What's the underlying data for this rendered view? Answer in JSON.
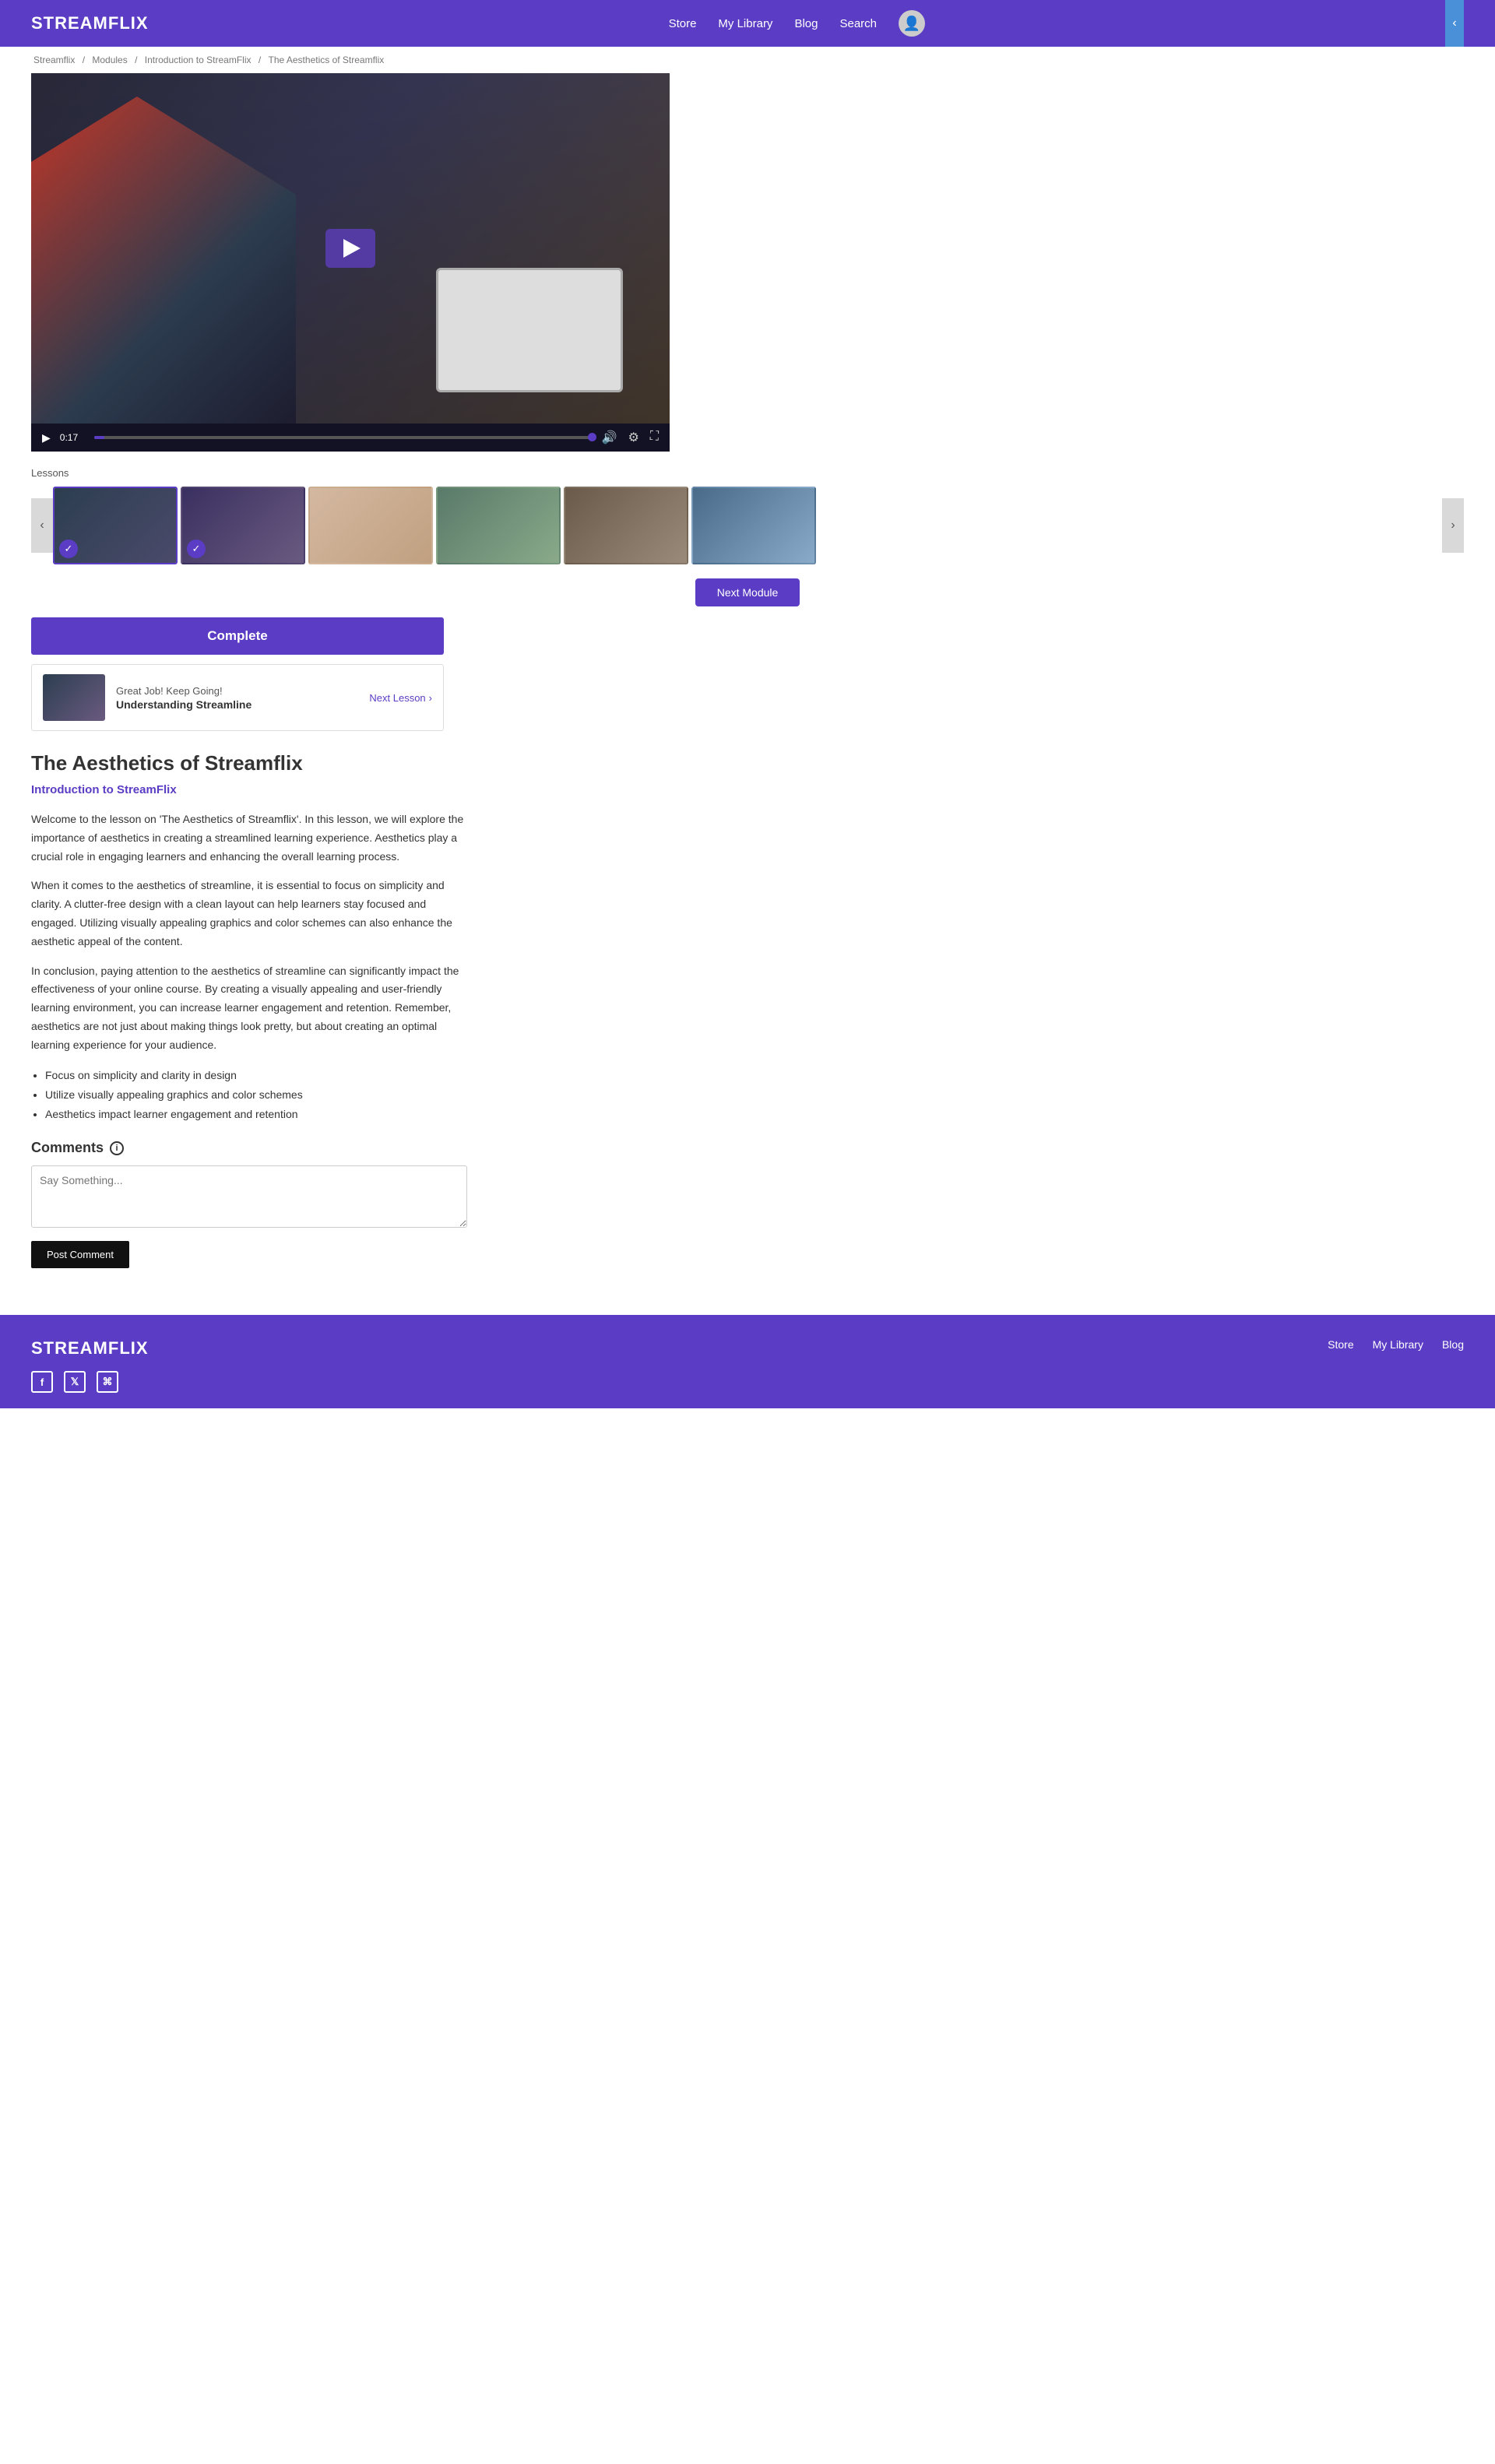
{
  "header": {
    "logo": "STREAMFLIX",
    "nav": {
      "store": "Store",
      "my_library": "My Library",
      "blog": "Blog",
      "search": "Search"
    }
  },
  "breadcrumb": {
    "items": [
      "Streamflix",
      "Modules",
      "Introduction to StreamFlix",
      "The Aesthetics of Streamflix"
    ]
  },
  "video": {
    "time_current": "0:17",
    "progress_pct": 2
  },
  "lessons": {
    "label": "Lessons",
    "items": [
      {
        "id": 1,
        "completed": true,
        "active": true,
        "bg_class": "ci-1"
      },
      {
        "id": 2,
        "completed": true,
        "active": false,
        "bg_class": "ci-2"
      },
      {
        "id": 3,
        "completed": false,
        "active": false,
        "bg_class": "ci-3"
      },
      {
        "id": 4,
        "completed": false,
        "active": false,
        "bg_class": "ci-4"
      },
      {
        "id": 5,
        "completed": false,
        "active": false,
        "bg_class": "ci-5"
      },
      {
        "id": 6,
        "completed": false,
        "active": false,
        "bg_class": "ci-6"
      }
    ],
    "next_module_btn": "Next Module"
  },
  "complete_bar": {
    "label": "Complete"
  },
  "next_lesson": {
    "label": "Great Job! Keep Going!",
    "title": "Understanding Streamline",
    "link_text": "Next Lesson",
    "chevron": "›"
  },
  "lesson_content": {
    "title": "The Aesthetics of Streamflix",
    "module_link": "Introduction to StreamFlix",
    "paragraphs": [
      "Welcome to the lesson on 'The Aesthetics of Streamflix'. In this lesson, we will explore the importance of aesthetics in creating a streamlined learning experience. Aesthetics play a crucial role in engaging learners and enhancing the overall learning process.",
      "When it comes to the aesthetics of streamline, it is essential to focus on simplicity and clarity. A clutter-free design with a clean layout can help learners stay focused and engaged. Utilizing visually appealing graphics and color schemes can also enhance the aesthetic appeal of the content.",
      "In conclusion, paying attention to the aesthetics of streamline can significantly impact the effectiveness of your online course. By creating a visually appealing and user-friendly learning environment, you can increase learner engagement and retention. Remember, aesthetics are not just about making things look pretty, but about creating an optimal learning experience for your audience."
    ],
    "bullets": [
      "Focus on simplicity and clarity in design",
      "Utilize visually appealing graphics and color schemes",
      "Aesthetics impact learner engagement and retention"
    ]
  },
  "comments": {
    "label": "Comments",
    "textarea_placeholder": "Say Something...",
    "post_btn": "Post Comment"
  },
  "footer": {
    "logo": "STREAMFLIX",
    "nav": {
      "store": "Store",
      "my_library": "My Library",
      "blog": "Blog"
    },
    "social": [
      {
        "icon": "f",
        "name": "facebook"
      },
      {
        "icon": "𝕏",
        "name": "twitter"
      },
      {
        "icon": "⌘",
        "name": "instagram"
      }
    ]
  }
}
